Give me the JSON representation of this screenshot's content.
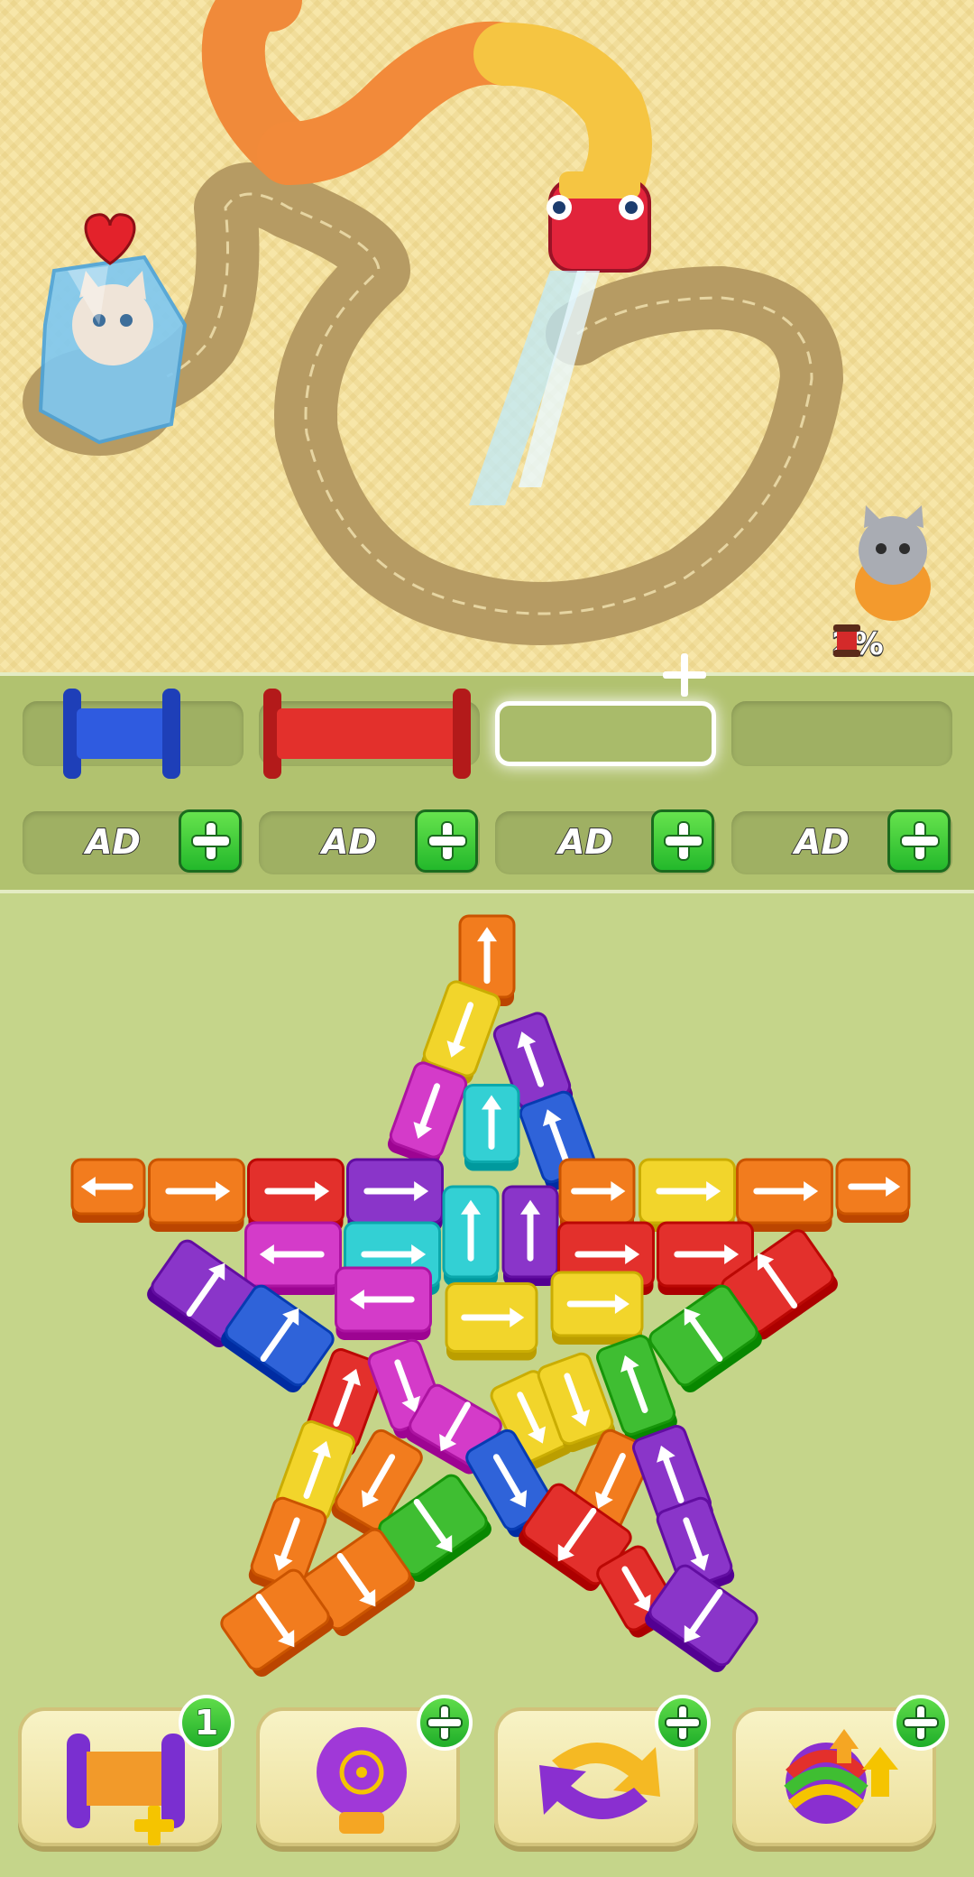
{
  "scene": {
    "progress_text": "2%",
    "icons": [
      "heart-icon",
      "frozen-cat-icon",
      "yarn-snake-icon",
      "gray-cat-icon",
      "spool-icon"
    ]
  },
  "slots": {
    "spools": [
      {
        "color": "#2a4fd6"
      },
      {
        "color": "#e02a2a"
      },
      {
        "color": null,
        "highlight": true
      },
      {
        "color": null
      }
    ],
    "ad_slots": [
      {
        "label": "AD"
      },
      {
        "label": "AD"
      },
      {
        "label": "AD"
      },
      {
        "label": "AD"
      }
    ]
  },
  "palette": {
    "orange": "#f27c1e",
    "red": "#e3302c",
    "yellow": "#f2d52b",
    "purple": "#8a35c9",
    "magenta": "#d43bc9",
    "cyan": "#33d0d4",
    "blue": "#2f63d9",
    "green": "#3fbe32"
  },
  "boosters": [
    {
      "name": "add-spool",
      "icon": "spool-plus-icon",
      "badge": "1"
    },
    {
      "name": "boxing-glove",
      "icon": "boxing-glove-icon",
      "badge": "+"
    },
    {
      "name": "shuffle",
      "icon": "shuffle-icon",
      "badge": "+"
    },
    {
      "name": "yarn-upgrade",
      "icon": "yarn-ball-icon",
      "badge": "+"
    }
  ]
}
